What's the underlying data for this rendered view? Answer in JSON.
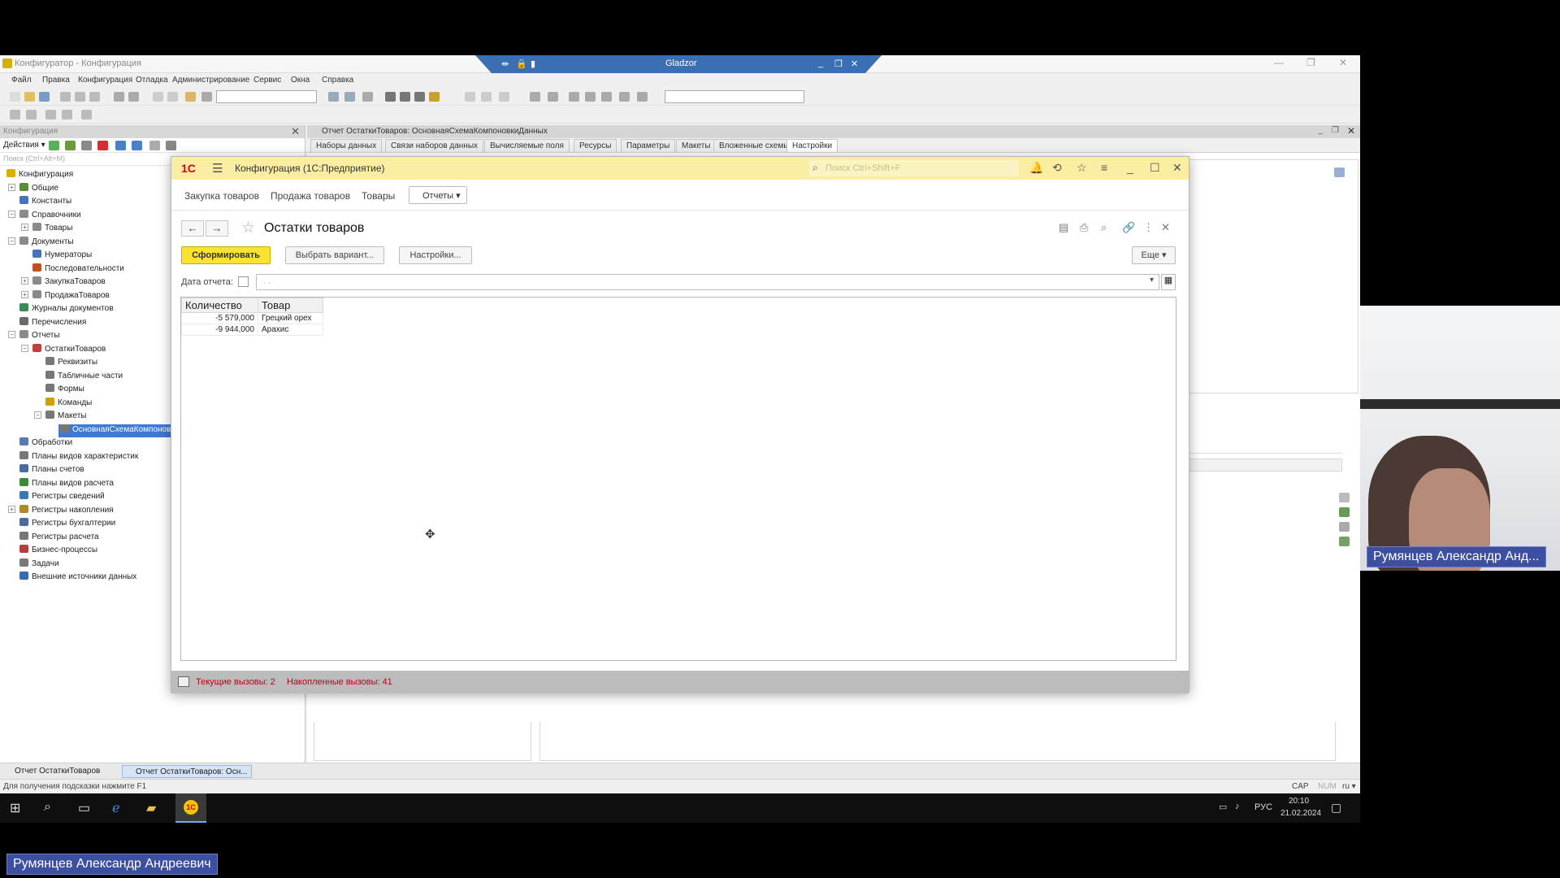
{
  "designer": {
    "title": "Конфигуратор - Конфигурация",
    "menu": [
      "Файл",
      "Правка",
      "Конфигурация",
      "Отладка",
      "Администрирование",
      "Сервис",
      "Окна",
      "Справка"
    ],
    "panel_title": "Конфигурация",
    "actions_label": "Действия ▾",
    "search_placeholder": "Поиск (Ctrl+Alt+M)",
    "tree": [
      {
        "label": "Конфигурация",
        "icon_color": "#d8b000"
      },
      {
        "label": "Общие",
        "icon_color": "#5b8c3a"
      },
      {
        "label": "Константы",
        "icon_color": "#4a72b8"
      },
      {
        "label": "Справочники",
        "icon_color": "#8a8a8a"
      },
      {
        "label": "Товары",
        "icon_color": "#8a8a8a"
      },
      {
        "label": "Документы",
        "icon_color": "#8a8a8a"
      },
      {
        "label": "Нумераторы",
        "icon_color": "#4a72b8"
      },
      {
        "label": "Последовательности",
        "icon_color": "#c05020"
      },
      {
        "label": "ЗакупкаТоваров",
        "icon_color": "#8a8a8a"
      },
      {
        "label": "ПродажаТоваров",
        "icon_color": "#8a8a8a"
      },
      {
        "label": "Журналы документов",
        "icon_color": "#3a8a5a"
      },
      {
        "label": "Перечисления",
        "icon_color": "#6a6a6a"
      },
      {
        "label": "Отчеты",
        "icon_color": "#8a8a8a"
      },
      {
        "label": "ОстаткиТоваров",
        "icon_color": "#c04040"
      },
      {
        "label": "Реквизиты",
        "icon_color": "#777"
      },
      {
        "label": "Табличные части",
        "icon_color": "#777"
      },
      {
        "label": "Формы",
        "icon_color": "#777"
      },
      {
        "label": "Команды",
        "icon_color": "#d0a000"
      },
      {
        "label": "Макеты",
        "icon_color": "#777"
      },
      {
        "label": "ОсновнаяСхемаКомпоновки",
        "icon_color": "#777"
      },
      {
        "label": "Обработки",
        "icon_color": "#5a7ab0"
      },
      {
        "label": "Планы видов характеристик",
        "icon_color": "#777"
      },
      {
        "label": "Планы счетов",
        "icon_color": "#4a6aa0"
      },
      {
        "label": "Планы видов расчета",
        "icon_color": "#3a8a3a"
      },
      {
        "label": "Регистры сведений",
        "icon_color": "#3a7ab0"
      },
      {
        "label": "Регистры накопления",
        "icon_color": "#b08a2a"
      },
      {
        "label": "Регистры бухгалтерии",
        "icon_color": "#4a6aa0"
      },
      {
        "label": "Регистры расчета",
        "icon_color": "#777"
      },
      {
        "label": "Бизнес-процессы",
        "icon_color": "#b04040"
      },
      {
        "label": "Задачи",
        "icon_color": "#777"
      },
      {
        "label": "Внешние источники данных",
        "icon_color": "#3a6ab0"
      }
    ],
    "editor_title": "Отчет ОстаткиТоваров: ОсновнаяСхемаКомпоновкиДанных",
    "editor_tabs": [
      "Наборы данных",
      "Связи наборов данных",
      "Вычисляемые поля",
      "Ресурсы",
      "Параметры",
      "Макеты",
      "Вложенные схемы",
      "Настройки"
    ],
    "active_tab": "Настройки",
    "doc_tabs": [
      "Отчет ОстаткиТоваров",
      "Отчет ОстаткиТоваров: Осн..."
    ],
    "status_hint": "Для получения подсказки нажмите F1",
    "status_indicators": [
      "CAP",
      "NUM",
      "ru ▾"
    ]
  },
  "remote_session": {
    "name": "Gladzor"
  },
  "enterprise": {
    "logo": "1С",
    "title": "Конфигурация  (1С:Предприятие)",
    "search_placeholder": "Поиск Ctrl+Shift+F",
    "sections": [
      "Закупка товаров",
      "Продажа товаров",
      "Товары"
    ],
    "reports_button": "Отчеты ▾",
    "form_title": "Остатки товаров",
    "generate_button": "Сформировать",
    "choose_variant_button": "Выбрать вариант...",
    "settings_button": "Настройки...",
    "more_button": "Еще ▾",
    "date_label": "Дата отчета:",
    "date_placeholder": ". .",
    "table": {
      "columns": [
        "Количество",
        "Товар"
      ],
      "rows": [
        {
          "qty": "-5 579,000",
          "item": "Грецкий орех"
        },
        {
          "qty": "-9 944,000",
          "item": "Арахис"
        }
      ]
    },
    "status": {
      "current_calls": "Текущие вызовы: 2",
      "accumulated_calls": "Накопленные вызовы: 41"
    }
  },
  "taskbar": {
    "lang": "РУС",
    "time": "20:10",
    "date": "21.02.2024"
  },
  "participants": {
    "webcam_name": "Румянцев Александр Анд...",
    "presenter_name": "Румянцев Александр Андреевич"
  },
  "colors": {
    "enterprise_title_bg": "#fbeda1",
    "generate_button_bg": "#fce231",
    "selection_blue": "#3d7ad6",
    "status_red": "#c0001a",
    "name_tag_bg": "#3c4fa0"
  }
}
